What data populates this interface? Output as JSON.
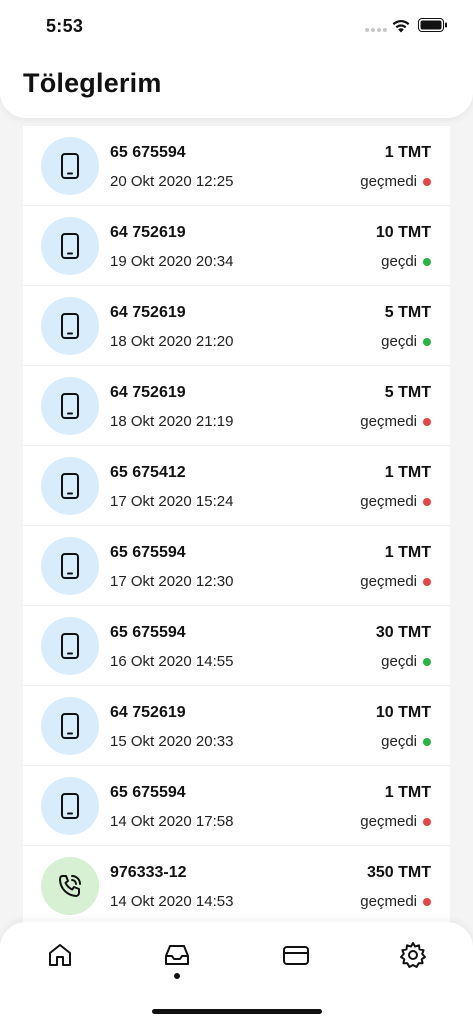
{
  "status_bar": {
    "time": "5:53"
  },
  "header": {
    "title": "Töleglerim"
  },
  "colors": {
    "mobile_icon_bg": "#d9ecfb",
    "landline_icon_bg": "#d7f0d3",
    "status_passed": "#2db24a",
    "status_failed": "#e24747"
  },
  "payments": [
    {
      "icon": "mobile-phone-icon",
      "number": "65 675594",
      "date": "20 Okt 2020 12:25",
      "amount": "1 TMT",
      "status": "geçmedi",
      "status_type": "failed"
    },
    {
      "icon": "mobile-phone-icon",
      "number": "64 752619",
      "date": "19 Okt 2020 20:34",
      "amount": "10 TMT",
      "status": "geçdi",
      "status_type": "passed"
    },
    {
      "icon": "mobile-phone-icon",
      "number": "64 752619",
      "date": "18 Okt 2020 21:20",
      "amount": "5 TMT",
      "status": "geçdi",
      "status_type": "passed"
    },
    {
      "icon": "mobile-phone-icon",
      "number": "64 752619",
      "date": "18 Okt 2020 21:19",
      "amount": "5 TMT",
      "status": "geçmedi",
      "status_type": "failed"
    },
    {
      "icon": "mobile-phone-icon",
      "number": "65 675412",
      "date": "17 Okt 2020 15:24",
      "amount": "1 TMT",
      "status": "geçmedi",
      "status_type": "failed"
    },
    {
      "icon": "mobile-phone-icon",
      "number": "65 675594",
      "date": "17 Okt 2020 12:30",
      "amount": "1 TMT",
      "status": "geçmedi",
      "status_type": "failed"
    },
    {
      "icon": "mobile-phone-icon",
      "number": "65 675594",
      "date": "16 Okt 2020 14:55",
      "amount": "30 TMT",
      "status": "geçdi",
      "status_type": "passed"
    },
    {
      "icon": "mobile-phone-icon",
      "number": "64 752619",
      "date": "15 Okt 2020 20:33",
      "amount": "10 TMT",
      "status": "geçdi",
      "status_type": "passed"
    },
    {
      "icon": "mobile-phone-icon",
      "number": "65 675594",
      "date": "14 Okt 2020 17:58",
      "amount": "1 TMT",
      "status": "geçmedi",
      "status_type": "failed"
    },
    {
      "icon": "landline-phone-icon",
      "number": "976333-12",
      "date": "14 Okt 2020 14:53",
      "amount": "350 TMT",
      "status": "geçmedi",
      "status_type": "failed"
    }
  ],
  "tabbar": {
    "tabs": [
      {
        "icon": "home-icon",
        "active": false
      },
      {
        "icon": "inbox-icon",
        "active": true
      },
      {
        "icon": "credit-card-icon",
        "active": false
      },
      {
        "icon": "settings-gear-icon",
        "active": false
      }
    ]
  }
}
